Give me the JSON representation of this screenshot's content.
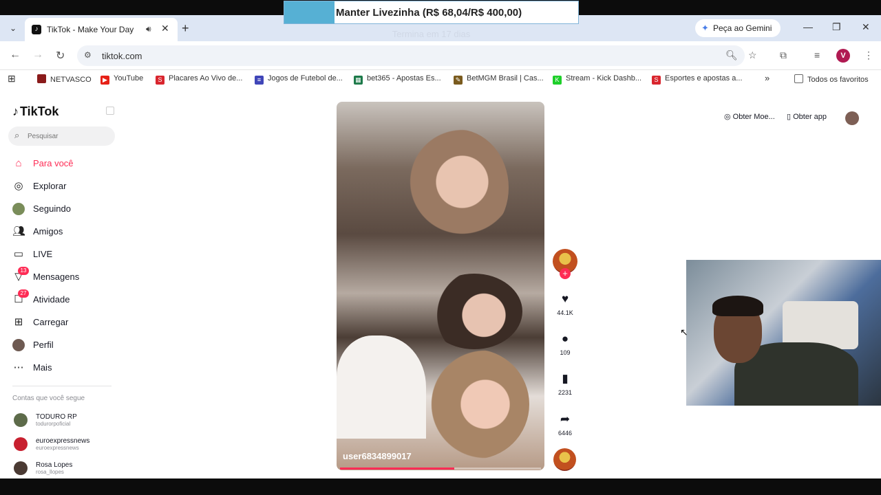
{
  "overlay": {
    "goal_text": "Manter Livezinha (R$ 68,04/R$ 400,00)",
    "goal_current": 68.04,
    "goal_target": 400.0,
    "subtext": "Termina em 17 dias"
  },
  "browser": {
    "tab_title": "TikTok - Make Your Day",
    "gemini_label": "Peça ao Gemini",
    "url": "tiktok.com",
    "profile_initial": "V",
    "bookmarks": [
      {
        "label": "NETVASCO",
        "color": "#8a1b1b"
      },
      {
        "label": "YouTube",
        "color": "#e62117"
      },
      {
        "label": "Placares Ao Vivo de...",
        "color": "#d9262e"
      },
      {
        "label": "Jogos de Futebol de...",
        "color": "#4046b8"
      },
      {
        "label": "bet365 - Apostas Es...",
        "color": "#1d7a4a"
      },
      {
        "label": "BetMGM Brasil | Cas...",
        "color": "#7a5b1e"
      },
      {
        "label": "Stream - Kick Dashb...",
        "color": "#1ecf2a"
      },
      {
        "label": "Esportes e apostas a...",
        "color": "#d9262e"
      }
    ],
    "all_bookmarks": "Todos os favoritos"
  },
  "tiktok": {
    "logo": "TikTok",
    "search_placeholder": "Pesquisar",
    "menu": [
      {
        "label": "Para você",
        "icon": "home-icon",
        "active": true
      },
      {
        "label": "Explorar",
        "icon": "compass-icon"
      },
      {
        "label": "Seguindo",
        "icon": "following-avatar-icon"
      },
      {
        "label": "Amigos",
        "icon": "friends-icon"
      },
      {
        "label": "LIVE",
        "icon": "live-icon"
      },
      {
        "label": "Mensagens",
        "icon": "messages-icon",
        "badge": "13"
      },
      {
        "label": "Atividade",
        "icon": "activity-icon",
        "badge": "27"
      },
      {
        "label": "Carregar",
        "icon": "upload-icon"
      },
      {
        "label": "Perfil",
        "icon": "profile-avatar-icon"
      },
      {
        "label": "Mais",
        "icon": "more-icon"
      }
    ],
    "following_title": "Contas que você segue",
    "following": [
      {
        "name": "TODURO RP",
        "handle": "todurorpoficial"
      },
      {
        "name": "euroexpressnews",
        "handle": "euroexpressnews"
      },
      {
        "name": "Rosa Lopes",
        "handle": "rosa_llopes"
      }
    ],
    "top_right": {
      "coins": "Obter Moe...",
      "app": "Obter app"
    },
    "video": {
      "username": "user6834899017",
      "progress": 0.57
    },
    "actions": {
      "likes": "44.1K",
      "comments": "109",
      "saves": "2231",
      "shares": "6446"
    }
  }
}
